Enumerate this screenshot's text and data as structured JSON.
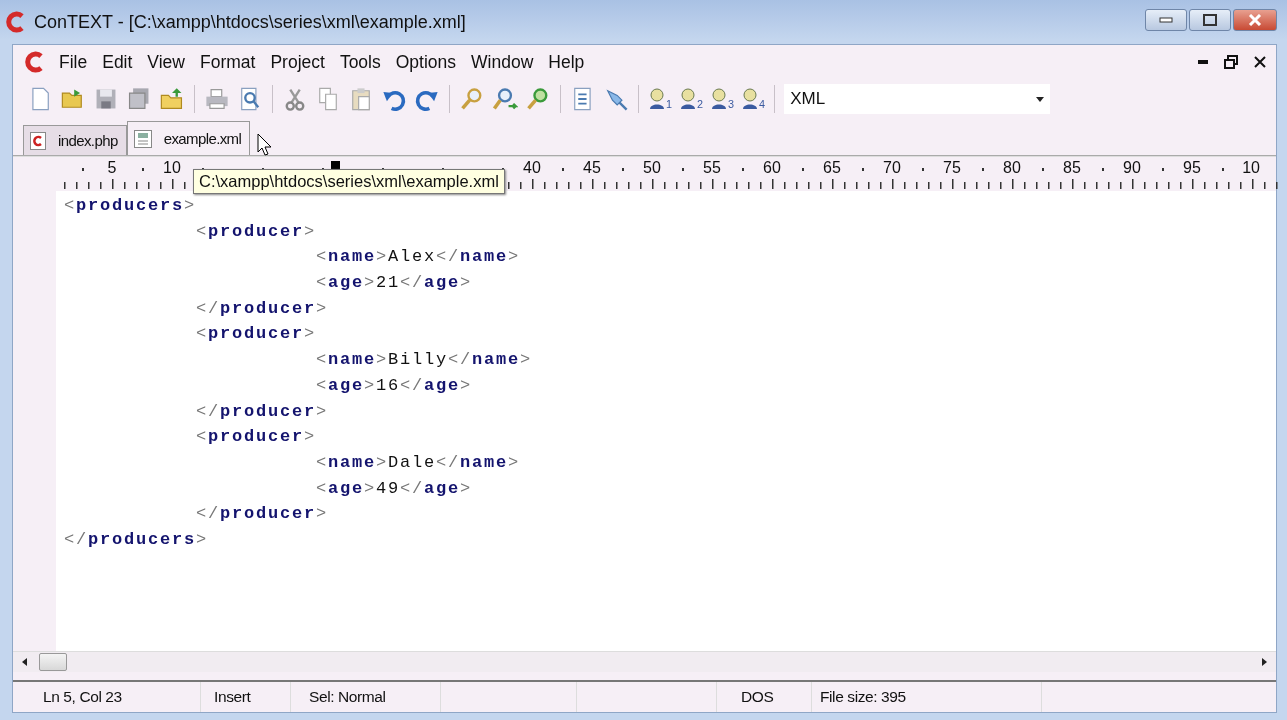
{
  "window": {
    "title": "ConTEXT - [C:\\xampp\\htdocs\\series\\xml\\example.xml]"
  },
  "menu": [
    "File",
    "Edit",
    "View",
    "Format",
    "Project",
    "Tools",
    "Options",
    "Window",
    "Help"
  ],
  "toolbar": {
    "user_profiles": [
      "1",
      "2",
      "3",
      "4"
    ],
    "highlighter": {
      "value": "XML"
    }
  },
  "tabs": [
    {
      "label": "index.php",
      "kind": "php",
      "selected": false
    },
    {
      "label": "example.xml",
      "kind": "xml",
      "selected": true
    }
  ],
  "tooltip": "C:\\xampp\\htdocs\\series\\xml\\example.xml",
  "ruler": {
    "before_tooltip": [
      "5",
      "10"
    ],
    "after_tooltip": [
      "40",
      "45",
      "50",
      "55",
      "60",
      "65",
      "70",
      "75",
      "80",
      "85",
      "90",
      "95",
      "10"
    ]
  },
  "code": [
    {
      "open": "<producers>",
      "close": "</producers>",
      "children": [
        {
          "open": "<producer>",
          "close": "</producer>",
          "children": [
            {
              "line": "<name>Alex</name>"
            },
            {
              "line": "<age>21</age>"
            }
          ]
        },
        {
          "open": "<producer>",
          "close": "</producer>",
          "children": [
            {
              "line": "<name>Billy</name>"
            },
            {
              "line": "<age>16</age>"
            }
          ]
        },
        {
          "open": "<producer>",
          "close": "</producer>",
          "children": [
            {
              "line": "<name>Dale</name>"
            },
            {
              "line": "<age>49</age>"
            }
          ]
        }
      ]
    }
  ],
  "status_bar": {
    "left": [
      "Ln 5, Col 23",
      "Insert",
      "Sel: Normal"
    ],
    "right": [
      "DOS",
      "File size: 395"
    ]
  }
}
